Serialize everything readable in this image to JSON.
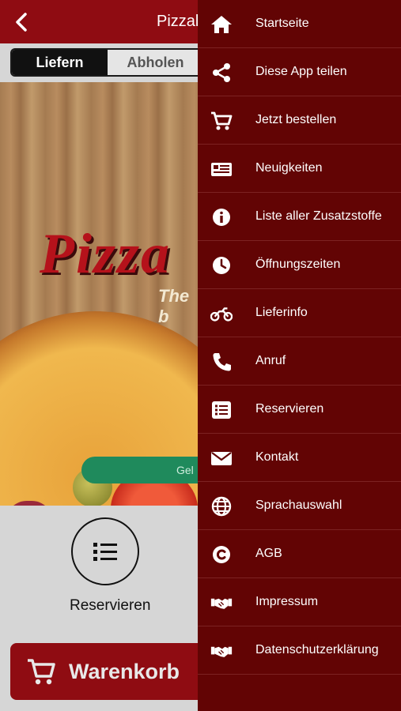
{
  "header": {
    "title": "Pizzal"
  },
  "tabs": [
    {
      "label": "Liefern",
      "active": true
    },
    {
      "label": "Abholen",
      "active": false
    }
  ],
  "hero": {
    "logo_text": "Pizza",
    "tagline": "The b",
    "status_pill": "Gel"
  },
  "quick_action": {
    "label": "Reservieren",
    "icon": "list-icon"
  },
  "cart": {
    "label": "Warenkorb",
    "icon": "cart-icon"
  },
  "colors": {
    "brand": "#8f0c12",
    "drawer": "#620404",
    "open_status": "#1f8a5c"
  },
  "menu": [
    {
      "label": "Startseite",
      "icon": "home-icon"
    },
    {
      "label": "Diese App teilen",
      "icon": "share-icon"
    },
    {
      "label": "Jetzt bestellen",
      "icon": "cart-icon"
    },
    {
      "label": "Neuigkeiten",
      "icon": "news-icon"
    },
    {
      "label": "Liste aller Zusatzstoffe",
      "icon": "info-icon"
    },
    {
      "label": "Öffnungszeiten",
      "icon": "clock-icon"
    },
    {
      "label": "Lieferinfo",
      "icon": "motorbike-icon"
    },
    {
      "label": "Anruf",
      "icon": "phone-icon"
    },
    {
      "label": "Reservieren",
      "icon": "list-icon"
    },
    {
      "label": "Kontakt",
      "icon": "mail-icon"
    },
    {
      "label": "Sprachauswahl",
      "icon": "globe-icon"
    },
    {
      "label": "AGB",
      "icon": "copyright-icon"
    },
    {
      "label": "Impressum",
      "icon": "handshake-icon"
    },
    {
      "label": "Datenschutzerklärung",
      "icon": "handshake-icon"
    }
  ]
}
